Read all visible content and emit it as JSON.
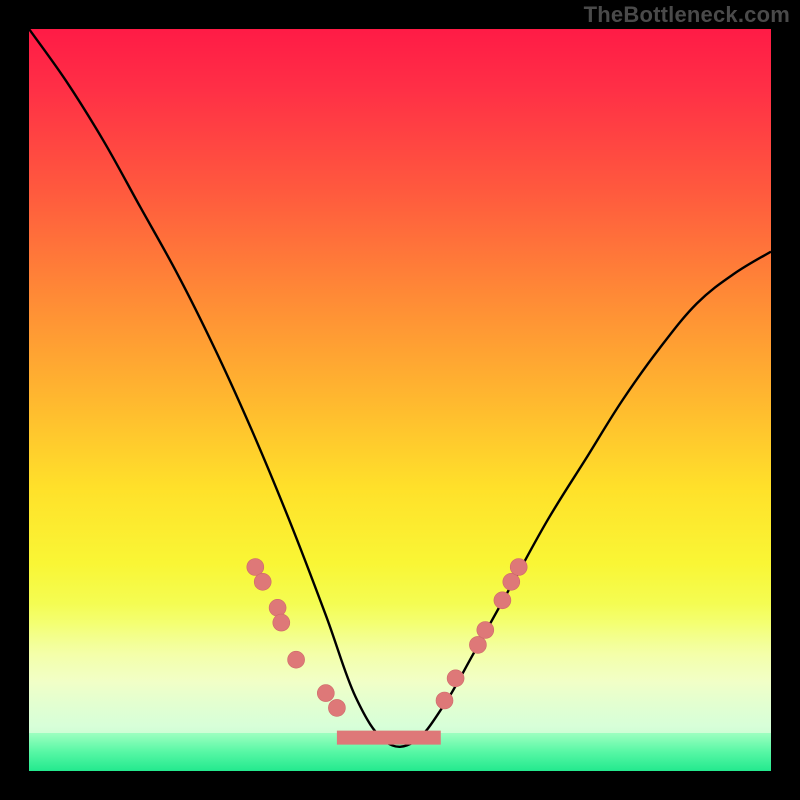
{
  "attribution": "TheBottleneck.com",
  "colors": {
    "dot": "#de7878",
    "curve": "#000000",
    "frame": "#000000"
  },
  "chart_data": {
    "type": "line",
    "title": "",
    "xlabel": "",
    "ylabel": "",
    "xlim": [
      0,
      100
    ],
    "ylim": [
      0,
      100
    ],
    "grid": false,
    "legend": false,
    "series": [
      {
        "name": "bottleneck-curve",
        "x": [
          0,
          5,
          10,
          15,
          20,
          25,
          30,
          35,
          40,
          44,
          48,
          52,
          56,
          60,
          65,
          70,
          75,
          80,
          85,
          90,
          95,
          100
        ],
        "y": [
          100,
          93,
          85,
          76,
          67,
          57,
          46,
          34,
          21,
          10,
          4,
          4,
          9,
          16,
          25,
          34,
          42,
          50,
          57,
          63,
          67,
          70
        ]
      }
    ],
    "markers_left": [
      {
        "x": 30.5,
        "y": 27.5
      },
      {
        "x": 31.5,
        "y": 25.5
      },
      {
        "x": 33.5,
        "y": 22.0
      },
      {
        "x": 34.0,
        "y": 20.0
      },
      {
        "x": 36.0,
        "y": 15.0
      },
      {
        "x": 40.0,
        "y": 10.5
      },
      {
        "x": 41.5,
        "y": 8.5
      }
    ],
    "markers_right": [
      {
        "x": 56.0,
        "y": 9.5
      },
      {
        "x": 57.5,
        "y": 12.5
      },
      {
        "x": 60.5,
        "y": 17.0
      },
      {
        "x": 61.5,
        "y": 19.0
      },
      {
        "x": 63.8,
        "y": 23.0
      },
      {
        "x": 65.0,
        "y": 25.5
      },
      {
        "x": 66.0,
        "y": 27.5
      }
    ],
    "marker_bottom_run": {
      "x_start": 41.5,
      "x_end": 55.5,
      "y": 4.5
    }
  }
}
